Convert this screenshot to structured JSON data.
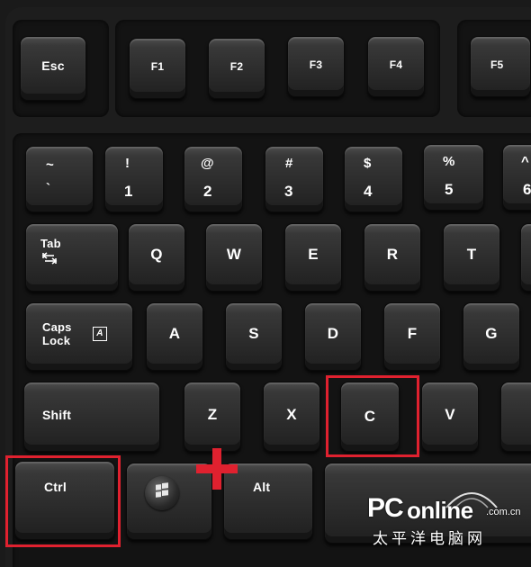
{
  "keys": {
    "esc": "Esc",
    "f1": "F1",
    "f2": "F2",
    "f3": "F3",
    "f4": "F4",
    "f5": "F5",
    "tilde_top": "~",
    "tilde_bottom": "`",
    "n1_top": "!",
    "n1": "1",
    "n2_top": "@",
    "n2": "2",
    "n3_top": "#",
    "n3": "3",
    "n4_top": "$",
    "n4": "4",
    "n5_top": "%",
    "n5": "5",
    "n6_top": "^",
    "n6": "6",
    "tab": "Tab",
    "q": "Q",
    "w": "W",
    "e": "E",
    "r": "R",
    "t": "T",
    "caps_line1": "Caps",
    "caps_line2": "Lock",
    "caps_indicator": "A",
    "a": "A",
    "s": "S",
    "d": "D",
    "f": "F",
    "g": "G",
    "shift": "Shift",
    "z": "Z",
    "x": "X",
    "c": "C",
    "v": "V",
    "ctrl": "Ctrl",
    "alt": "Alt"
  },
  "watermark": {
    "brand_p": "PC",
    "brand_rest": "online",
    "domain": ".com.cn",
    "chinese": "太平洋电脑网"
  },
  "annotations": {
    "highlighted_keys": [
      "Ctrl",
      "C"
    ],
    "combination_symbol": "+",
    "accent_color": "#e0212f"
  }
}
